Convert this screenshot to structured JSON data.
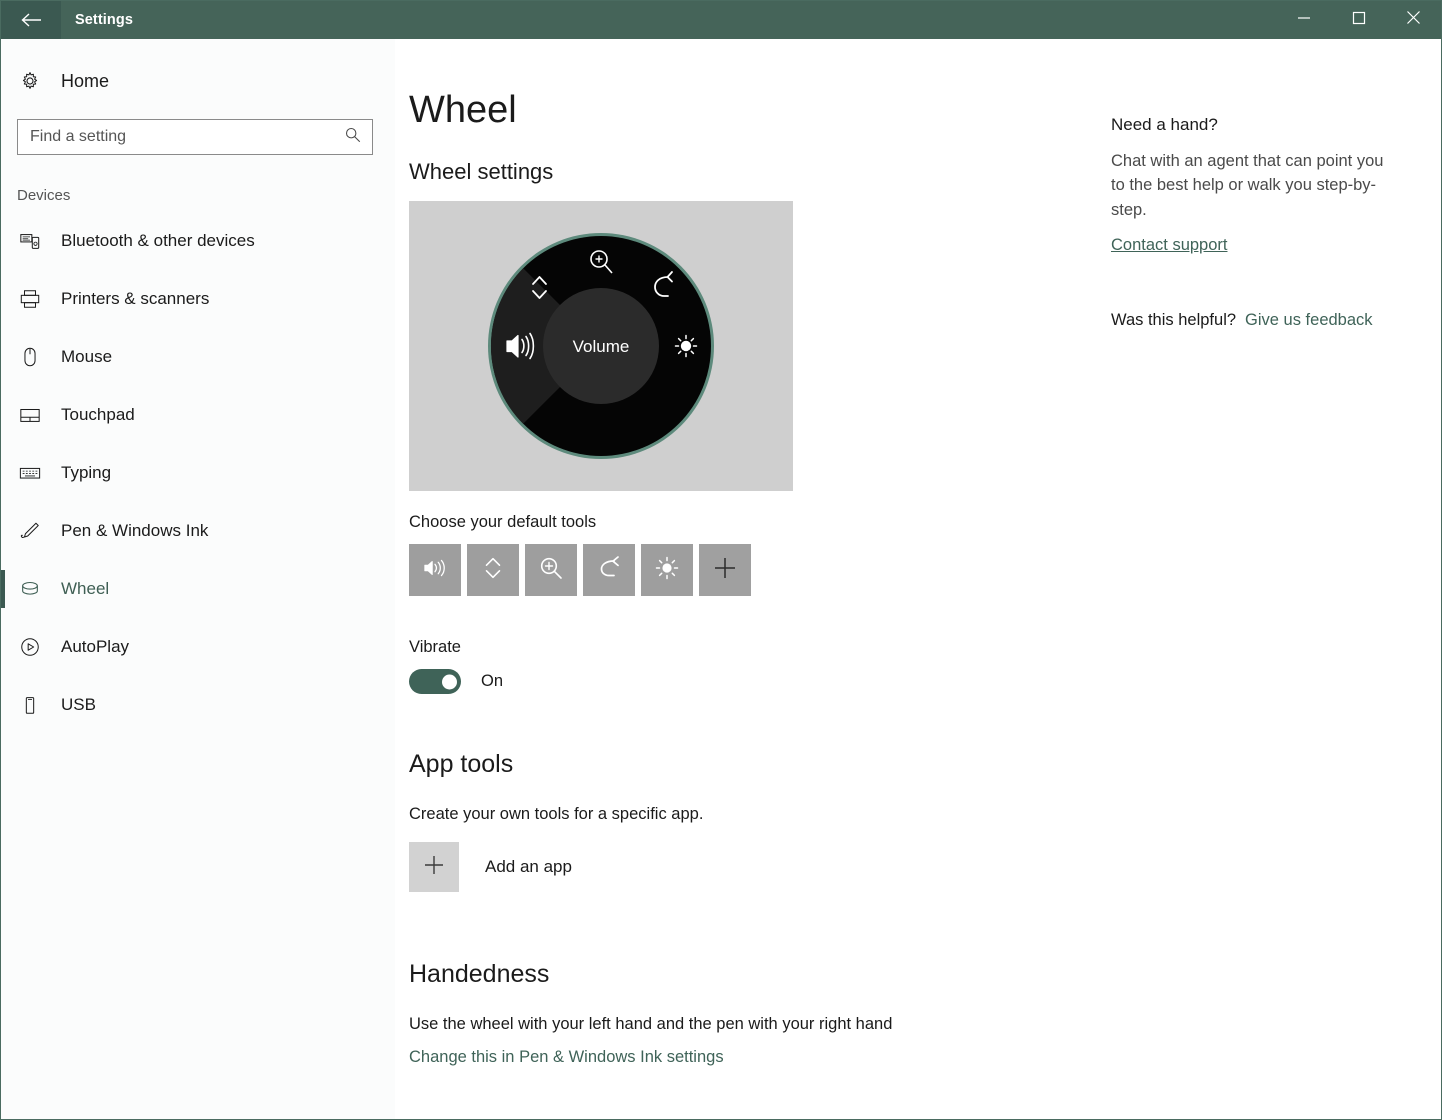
{
  "titlebar": {
    "back_icon": "back-arrow-icon",
    "title": "Settings",
    "minimize_label": "Minimize",
    "maximize_label": "Maximize",
    "close_label": "Close"
  },
  "sidebar": {
    "home_label": "Home",
    "home_icon": "gear-icon",
    "search": {
      "placeholder": "Find a setting",
      "value": "",
      "icon": "search-icon"
    },
    "group_label": "Devices",
    "items": [
      {
        "label": "Bluetooth & other devices",
        "icon": "bluetooth-devices-icon",
        "selected": false
      },
      {
        "label": "Printers & scanners",
        "icon": "printer-icon",
        "selected": false
      },
      {
        "label": "Mouse",
        "icon": "mouse-icon",
        "selected": false
      },
      {
        "label": "Touchpad",
        "icon": "touchpad-icon",
        "selected": false
      },
      {
        "label": "Typing",
        "icon": "keyboard-icon",
        "selected": false
      },
      {
        "label": "Pen & Windows Ink",
        "icon": "pen-icon",
        "selected": false
      },
      {
        "label": "Wheel",
        "icon": "wheel-icon",
        "selected": true
      },
      {
        "label": "AutoPlay",
        "icon": "autoplay-icon",
        "selected": false
      },
      {
        "label": "USB",
        "icon": "usb-icon",
        "selected": false
      }
    ]
  },
  "main": {
    "page_title": "Wheel",
    "wheel_settings_heading": "Wheel settings",
    "wheel_preview": {
      "center_label": "Volume",
      "segments": [
        {
          "name": "scroll",
          "icon": "scroll-updown-icon",
          "selected": false
        },
        {
          "name": "zoom",
          "icon": "zoom-in-icon",
          "selected": false
        },
        {
          "name": "undo",
          "icon": "undo-icon",
          "selected": false
        },
        {
          "name": "brightness",
          "icon": "brightness-icon",
          "selected": false
        },
        {
          "name": "volume",
          "icon": "volume-icon",
          "selected": true
        }
      ]
    },
    "default_tools_label": "Choose your default tools",
    "default_tools": [
      {
        "name": "volume",
        "icon": "volume-icon"
      },
      {
        "name": "scroll",
        "icon": "scroll-updown-icon"
      },
      {
        "name": "zoom",
        "icon": "zoom-in-icon"
      },
      {
        "name": "undo",
        "icon": "undo-icon"
      },
      {
        "name": "brightness",
        "icon": "brightness-icon"
      },
      {
        "name": "add",
        "icon": "plus-icon"
      }
    ],
    "vibrate": {
      "label": "Vibrate",
      "state": "On",
      "on": true
    },
    "app_tools": {
      "heading": "App tools",
      "description": "Create your own tools for a specific app.",
      "add_app_label": "Add an app",
      "add_app_icon": "plus-icon"
    },
    "handedness": {
      "heading": "Handedness",
      "description": "Use the wheel with your left hand and the pen with your right hand",
      "link": "Change this in Pen & Windows Ink settings"
    }
  },
  "help": {
    "title": "Need a hand?",
    "body": "Chat with an agent that can point you to the best help or walk you step-by-step.",
    "contact_link": "Contact support",
    "feedback_question": "Was this helpful?",
    "feedback_link": "Give us feedback"
  },
  "colors": {
    "titlebar": "#456459",
    "accent": "#3f6358",
    "selection_bar": "#3b5951",
    "tile": "#9e9e9e",
    "wheel_background": "#cfcfcf"
  }
}
